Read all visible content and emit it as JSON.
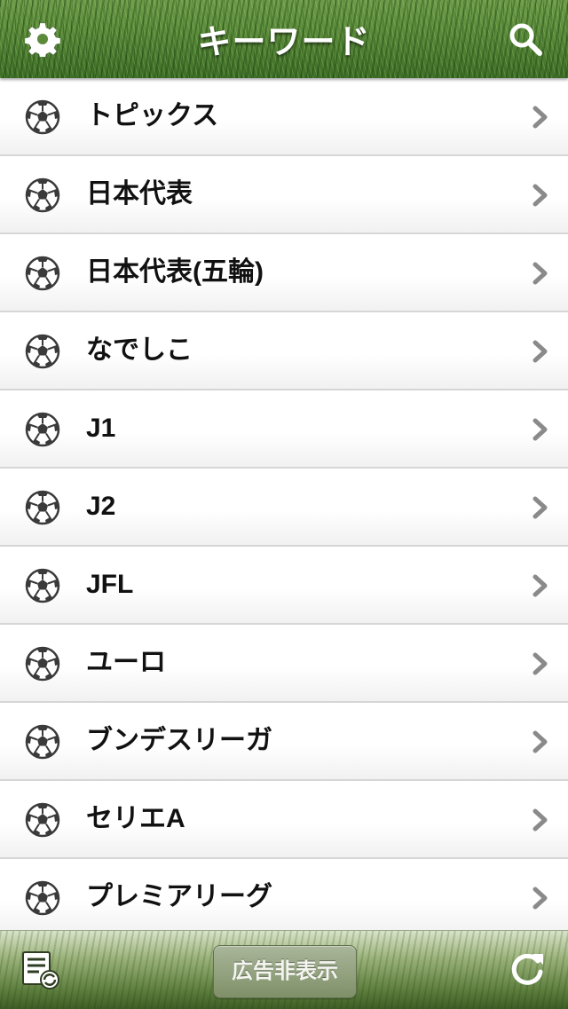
{
  "header": {
    "title": "キーワード",
    "left_icon": "gear-icon",
    "right_icon": "search-icon"
  },
  "list": {
    "items": [
      {
        "label": "トピックス",
        "icon": "soccer-ball-icon"
      },
      {
        "label": "日本代表",
        "icon": "soccer-ball-icon"
      },
      {
        "label": "日本代表(五輪)",
        "icon": "soccer-ball-icon"
      },
      {
        "label": "なでしこ",
        "icon": "soccer-ball-icon"
      },
      {
        "label": "J1",
        "icon": "soccer-ball-icon"
      },
      {
        "label": "J2",
        "icon": "soccer-ball-icon"
      },
      {
        "label": "JFL",
        "icon": "soccer-ball-icon"
      },
      {
        "label": "ユーロ",
        "icon": "soccer-ball-icon"
      },
      {
        "label": "ブンデスリーガ",
        "icon": "soccer-ball-icon"
      },
      {
        "label": "セリエA",
        "icon": "soccer-ball-icon"
      },
      {
        "label": "プレミアリーグ",
        "icon": "soccer-ball-icon"
      }
    ]
  },
  "toolbar": {
    "left_icon": "edit-list-icon",
    "ad_button_label": "広告非表示",
    "right_icon": "refresh-icon"
  },
  "colors": {
    "header_grass": "#5a8a3a",
    "toolbar_grass": "#5f7f3f",
    "text": "#111111",
    "chevron": "#8a8a8a"
  }
}
